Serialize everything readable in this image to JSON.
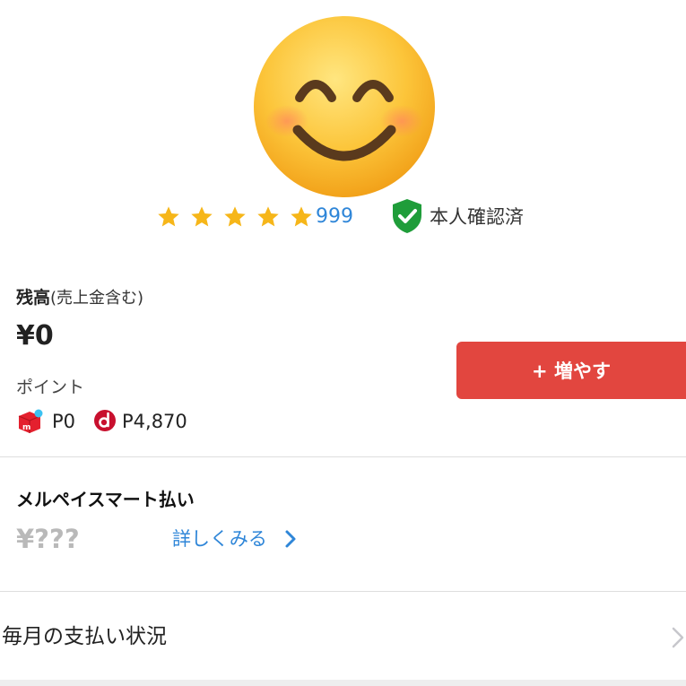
{
  "profile": {
    "avatar": "smiling-face-emoji",
    "rating": {
      "stars": 5,
      "count": "999"
    },
    "verified_label": "本人確認済"
  },
  "balance": {
    "title": "残高",
    "subtitle": "(売上金含む)",
    "amount": "¥0",
    "points_label": "ポイント",
    "mercari_points": "P0",
    "d_points": "P4,870",
    "add_button_label": "+ 増やす"
  },
  "smart_pay": {
    "title": "メルペイスマート払い",
    "amount": "¥???",
    "details_link": "詳しくみる"
  },
  "monthly": {
    "label": "毎月の支払い状況"
  },
  "colors": {
    "accent_red": "#e2463f",
    "link_blue": "#2f86d8",
    "star_yellow": "#f6b619",
    "verified_green": "#1f9d3a"
  }
}
